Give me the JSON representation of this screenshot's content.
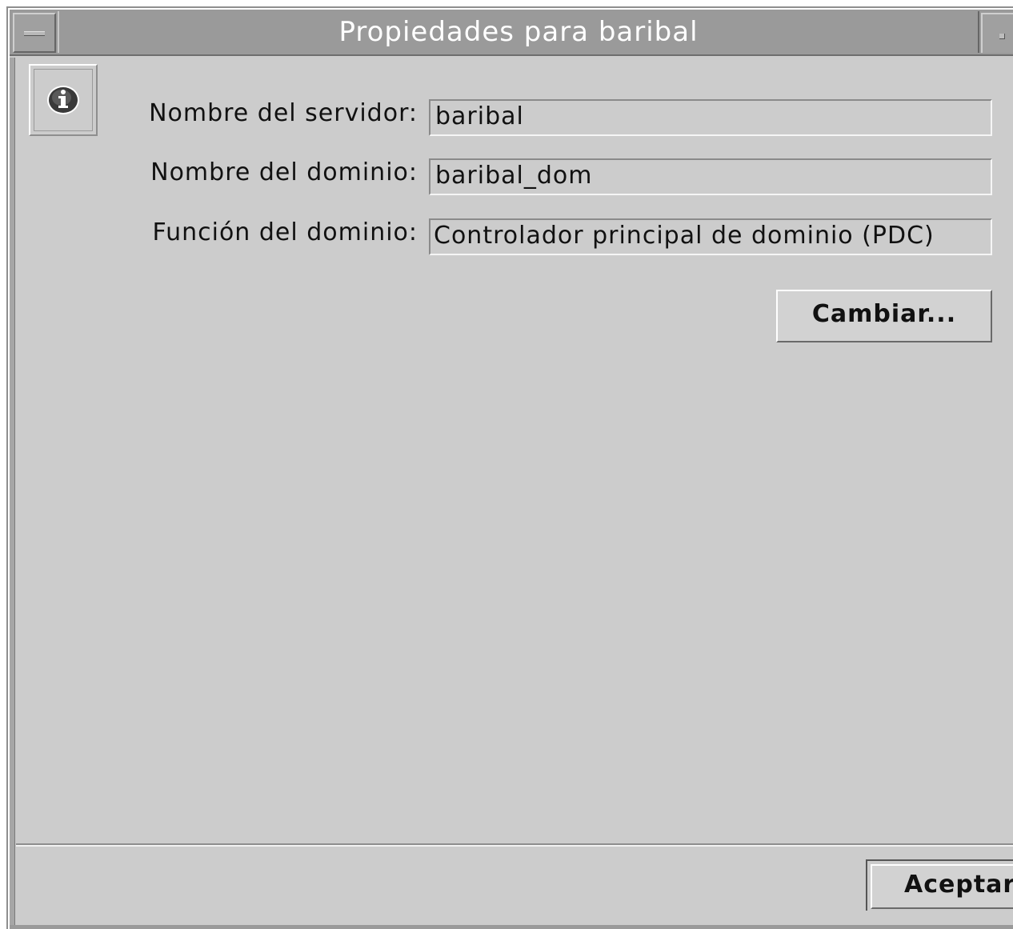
{
  "window": {
    "title": "Propiedades para baribal"
  },
  "form": {
    "server_name_label": "Nombre del servidor:",
    "server_name_value": "baribal",
    "domain_name_label": "Nombre del dominio:",
    "domain_name_value": "baribal_dom",
    "domain_role_label": "Función del dominio:",
    "domain_role_value": "Controlador principal de dominio (PDC)"
  },
  "buttons": {
    "change_label": "Cambiar...",
    "accept_label": "Aceptar"
  },
  "icons": {
    "window_menu": "window-menu-icon",
    "minimize": "minimize-icon",
    "info": "info-icon"
  },
  "colors": {
    "background": "#cccccc",
    "titlebar": "#9a9a9a",
    "title_text": "#ffffff"
  }
}
